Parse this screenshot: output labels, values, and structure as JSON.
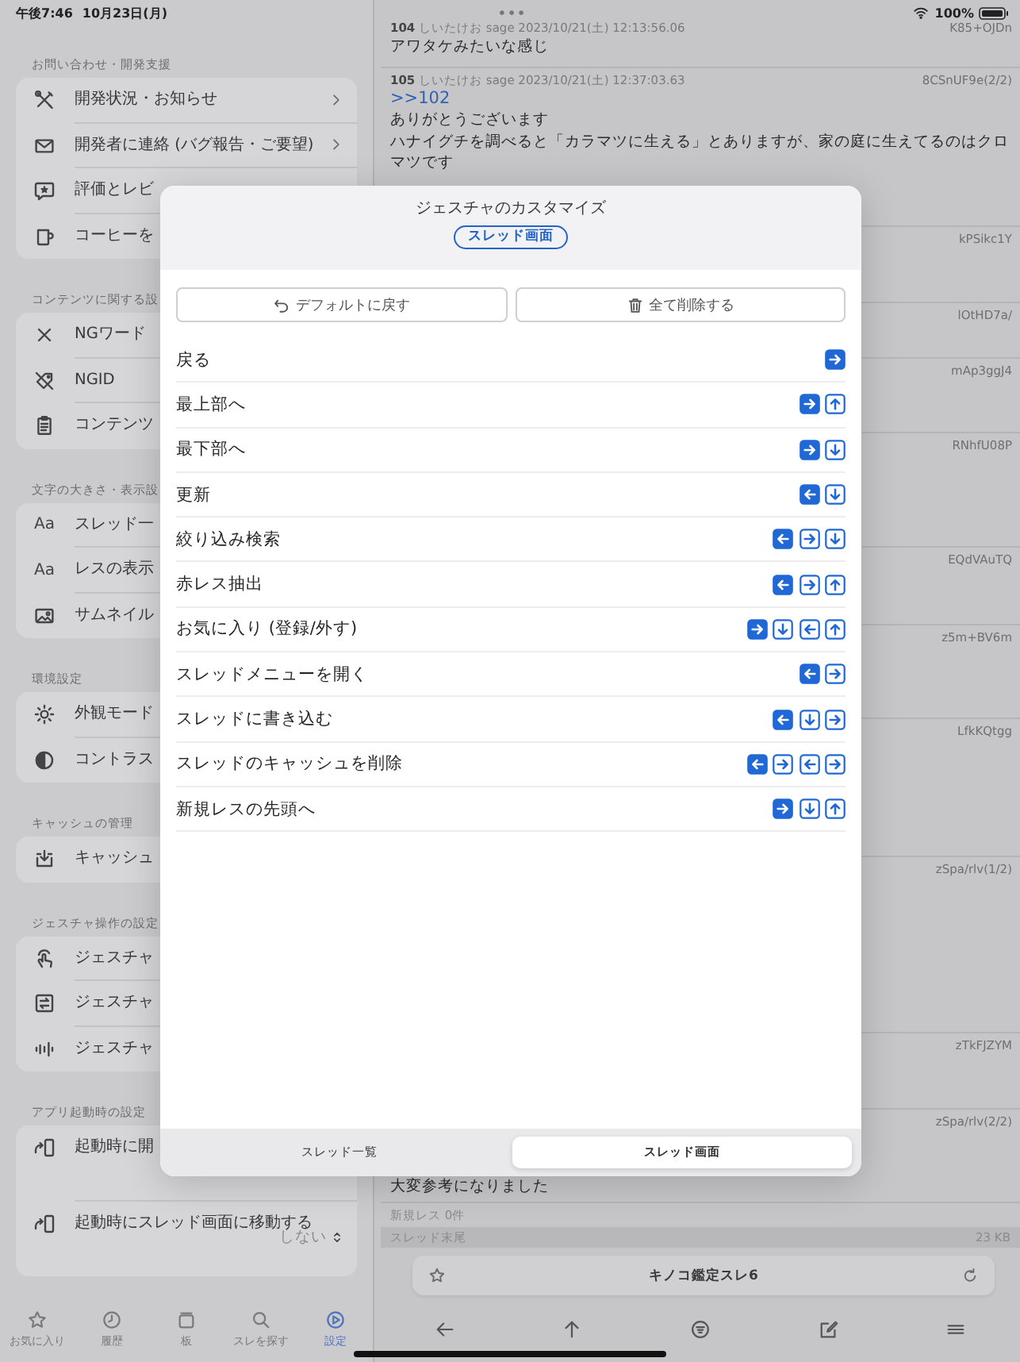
{
  "status_bar": {
    "time": "午後7:46",
    "date": "10月23日(月)",
    "dots": "•••",
    "battery": "100%"
  },
  "sidebar": {
    "sections": [
      {
        "title": "お問い合わせ・開発支援",
        "items": [
          {
            "kind": "link",
            "label": "開発状況・お知らせ",
            "chevron": true
          },
          {
            "kind": "link",
            "label": "開発者に連絡 (バグ報告・ご要望)",
            "chevron": true
          },
          {
            "kind": "link",
            "label": "評価とレビ",
            "chevron": false
          },
          {
            "kind": "link",
            "label": "コーヒーを",
            "chevron": false
          }
        ]
      },
      {
        "title": "コンテンツに関する設",
        "items": [
          {
            "kind": "link",
            "label": "NGワード",
            "chevron": false
          },
          {
            "kind": "link",
            "label": "NGID",
            "chevron": false
          },
          {
            "kind": "link",
            "label": "コンテンツ",
            "chevron": false
          }
        ]
      },
      {
        "title": "文字の大きさ・表示設",
        "items": [
          {
            "kind": "link",
            "glyph": "Aa",
            "label": "スレッド一",
            "chevron": false
          },
          {
            "kind": "link",
            "glyph": "Aa",
            "label": "レスの表示",
            "chevron": false
          },
          {
            "kind": "link",
            "label": "サムネイル",
            "chevron": false
          }
        ]
      },
      {
        "title": "環境設定",
        "items": [
          {
            "kind": "link",
            "label": "外観モード",
            "chevron": false
          },
          {
            "kind": "link",
            "label": "コントラス",
            "chevron": false
          }
        ]
      },
      {
        "title": "キャッシュの管理",
        "items": [
          {
            "kind": "link",
            "label": "キャッシュ",
            "chevron": false
          }
        ]
      },
      {
        "title": "ジェスチャ操作の設定",
        "items": [
          {
            "kind": "link",
            "label": "ジェスチャ",
            "chevron": false
          },
          {
            "kind": "link",
            "label": "ジェスチャ",
            "chevron": false
          },
          {
            "kind": "link",
            "label": "ジェスチャ",
            "chevron": false
          }
        ]
      },
      {
        "title": "アプリ起動時の設定",
        "items": [
          {
            "kind": "picker",
            "label": "起動時に開"
          },
          {
            "kind": "picker",
            "label": "起動時にスレッド画面に移動する",
            "value": "しない"
          }
        ]
      }
    ],
    "tabs": [
      {
        "label": "お気に入り",
        "selected": false
      },
      {
        "label": "履歴",
        "selected": false
      },
      {
        "label": "板",
        "selected": false
      },
      {
        "label": "スレを探す",
        "selected": false
      },
      {
        "label": "設定",
        "selected": true
      }
    ]
  },
  "thread": {
    "posts": [
      {
        "header": "**104** しいたけお sage 2023/10/21(土) 12:13:56.06",
        "id": "K85+OJDn",
        "lines": [
          "アワタケみたいな感じ"
        ]
      },
      {
        "header": "**105** しいたけお sage 2023/10/21(土) 12:37:03.63",
        "id": "8CSnUF9e(2/2)",
        "anchor": ">>102",
        "lines": [
          "ありがとうございます",
          "ハナイグチを調べると「カラマツに生える」とありますが、家の庭に生えてるのはクロマツです"
        ]
      },
      {
        "id": "kPSikc1Y"
      },
      {
        "id": "lOtHD7a/"
      },
      {
        "id": "mAp3ggJ4"
      },
      {
        "id": "RNhfU08P"
      },
      {
        "id": "EQdVAuTQ"
      },
      {
        "id": "z5m+BV6m"
      },
      {
        "id": "LfkKQtgg"
      },
      {
        "id": "zSpa/rlv(1/2)"
      },
      {
        "id": "zTkFJZYM"
      },
      {
        "id": "zSpa/rlv(2/2)",
        "lines": [
          "大変参考になりました"
        ]
      }
    ],
    "new_count": "新規レス 0件",
    "end_label": "スレッド末尾",
    "size": "23 KB",
    "title": "キノコ鑑定スレ6"
  },
  "modal": {
    "title": "ジェスチャのカスタマイズ",
    "badge": "スレッド画面",
    "buttons": [
      {
        "label": "デフォルトに戻す"
      },
      {
        "label": "全て削除する"
      }
    ],
    "gestures": [
      {
        "label": "戻る",
        "steps": [
          {
            "kind": "right",
            "filled": true
          }
        ]
      },
      {
        "label": "最上部へ",
        "steps": [
          {
            "kind": "right",
            "filled": true
          },
          {
            "kind": "up",
            "filled": false
          }
        ]
      },
      {
        "label": "最下部へ",
        "steps": [
          {
            "kind": "right",
            "filled": true
          },
          {
            "kind": "down",
            "filled": false
          }
        ]
      },
      {
        "label": "更新",
        "steps": [
          {
            "kind": "left",
            "filled": true
          },
          {
            "kind": "down",
            "filled": false
          }
        ]
      },
      {
        "label": "絞り込み検索",
        "steps": [
          {
            "kind": "left",
            "filled": true
          },
          {
            "kind": "right",
            "filled": false
          },
          {
            "kind": "down",
            "filled": false
          }
        ]
      },
      {
        "label": "赤レス抽出",
        "steps": [
          {
            "kind": "left",
            "filled": true
          },
          {
            "kind": "right",
            "filled": false
          },
          {
            "kind": "up",
            "filled": false
          }
        ]
      },
      {
        "label": "お気に入り (登録/外す)",
        "steps": [
          {
            "kind": "right",
            "filled": true
          },
          {
            "kind": "down",
            "filled": false
          },
          {
            "kind": "left",
            "filled": false
          },
          {
            "kind": "up",
            "filled": false
          }
        ]
      },
      {
        "label": "スレッドメニューを開く",
        "steps": [
          {
            "kind": "left",
            "filled": true
          },
          {
            "kind": "right",
            "filled": false
          }
        ]
      },
      {
        "label": "スレッドに書き込む",
        "steps": [
          {
            "kind": "left",
            "filled": true
          },
          {
            "kind": "down",
            "filled": false
          },
          {
            "kind": "right",
            "filled": false
          }
        ]
      },
      {
        "label": "スレッドのキャッシュを削除",
        "steps": [
          {
            "kind": "left",
            "filled": true
          },
          {
            "kind": "right",
            "filled": false
          },
          {
            "kind": "left",
            "filled": false
          },
          {
            "kind": "right",
            "filled": false
          }
        ]
      },
      {
        "label": "新規レスの先頭へ",
        "steps": [
          {
            "kind": "right",
            "filled": true
          },
          {
            "kind": "down",
            "filled": false
          },
          {
            "kind": "up",
            "filled": false
          }
        ]
      }
    ],
    "segments": [
      {
        "label": "スレッド一覧",
        "selected": false
      },
      {
        "label": "スレッド画面",
        "selected": true
      }
    ]
  }
}
